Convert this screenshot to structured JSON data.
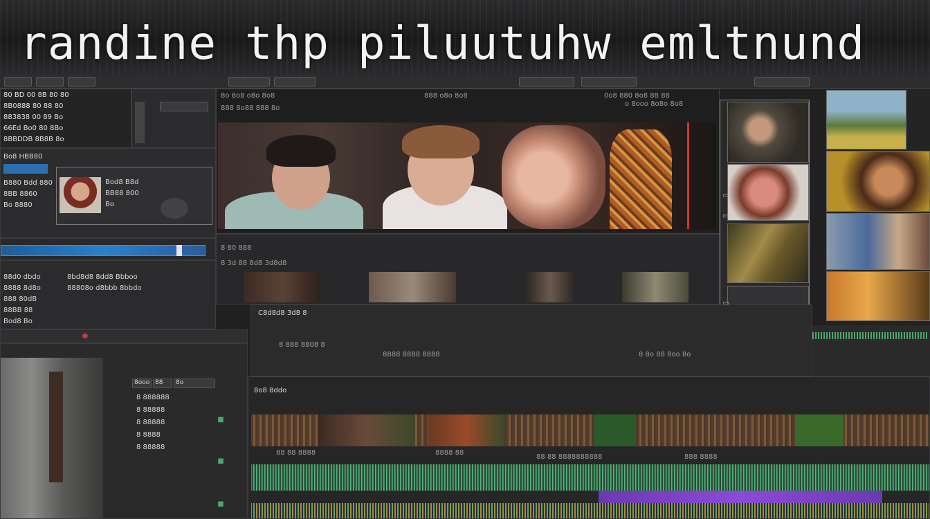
{
  "title": "randine thp piluutuhw emltnund",
  "left_menu": {
    "rows": [
      "80 BD 00 8B 80 80",
      "8B0888 80 88 80",
      "883838 00 89 Bo",
      "66Ed Bo0 80 8Bo",
      "8BBDDB 8B8B 8o"
    ]
  },
  "left_panel": {
    "label1": "Bo8 HBB80",
    "label2": "B880 Bdd 880",
    "label3": "8BB 8860",
    "label4": "Bo 8880",
    "clip_labels": [
      "Bod8 B8d",
      "BB88 800",
      "Bo"
    ]
  },
  "left_lower": {
    "rows": [
      "88d0 dbdo",
      "8888 8d8o",
      "888 80dB",
      "88BB 88",
      "Bod8 Bo"
    ],
    "col2": [
      "8bd8d8 8dd8 Bbboo",
      "88808o d8bbb 8bbdo"
    ]
  },
  "viewer": {
    "header_left": "8o 8o8 o8o 8o8",
    "header_mid": "888 o8o 8o8",
    "header_right": "0o8 880 8o8 88 88",
    "sub_left": "888 8o88 888 8o",
    "sub_right": "o 8ooo 8o8o 8o8"
  },
  "strip": {
    "label": "8 3d 88 8d8 3d8d8",
    "under_label": "8 80 888"
  },
  "middle": {
    "title": "C8d8d8 3d8 8",
    "rows": [
      "8 888 8808 8",
      "8888 8888 8888",
      "8 8o 88 8oo 8o"
    ]
  },
  "timeline": {
    "title": "8o8 8ddo",
    "marker_label": "88 88 8888888888",
    "track_labels": [
      "88 88 8888",
      "8888 88",
      "888 8888"
    ]
  },
  "lower_left": {
    "tabs": [
      "8ooo",
      "88",
      "8o"
    ],
    "rows": [
      "8 888888",
      "8 88888",
      "8 88888",
      "8 8888",
      "8 88888"
    ]
  },
  "colors": {
    "accent_blue": "#2b7fc9",
    "clip_purple": "#8a4bd6",
    "audio_green": "#4aa86b"
  }
}
